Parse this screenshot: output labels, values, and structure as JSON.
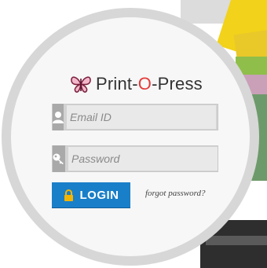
{
  "brand": {
    "name_prefix": "Print-",
    "name_o": "O",
    "name_suffix": "-Press",
    "icon": "butterfly-icon"
  },
  "form": {
    "email_placeholder": "Email ID",
    "password_placeholder": "Password",
    "login_label": "LOGIN",
    "forgot_label": "forgot password?"
  },
  "icons": {
    "email_field": "user-icon",
    "password_field": "key-icon",
    "login_button": "lock-icon"
  },
  "colors": {
    "login_button": "#1a7fc9",
    "brand_o": "#e43a3a"
  }
}
